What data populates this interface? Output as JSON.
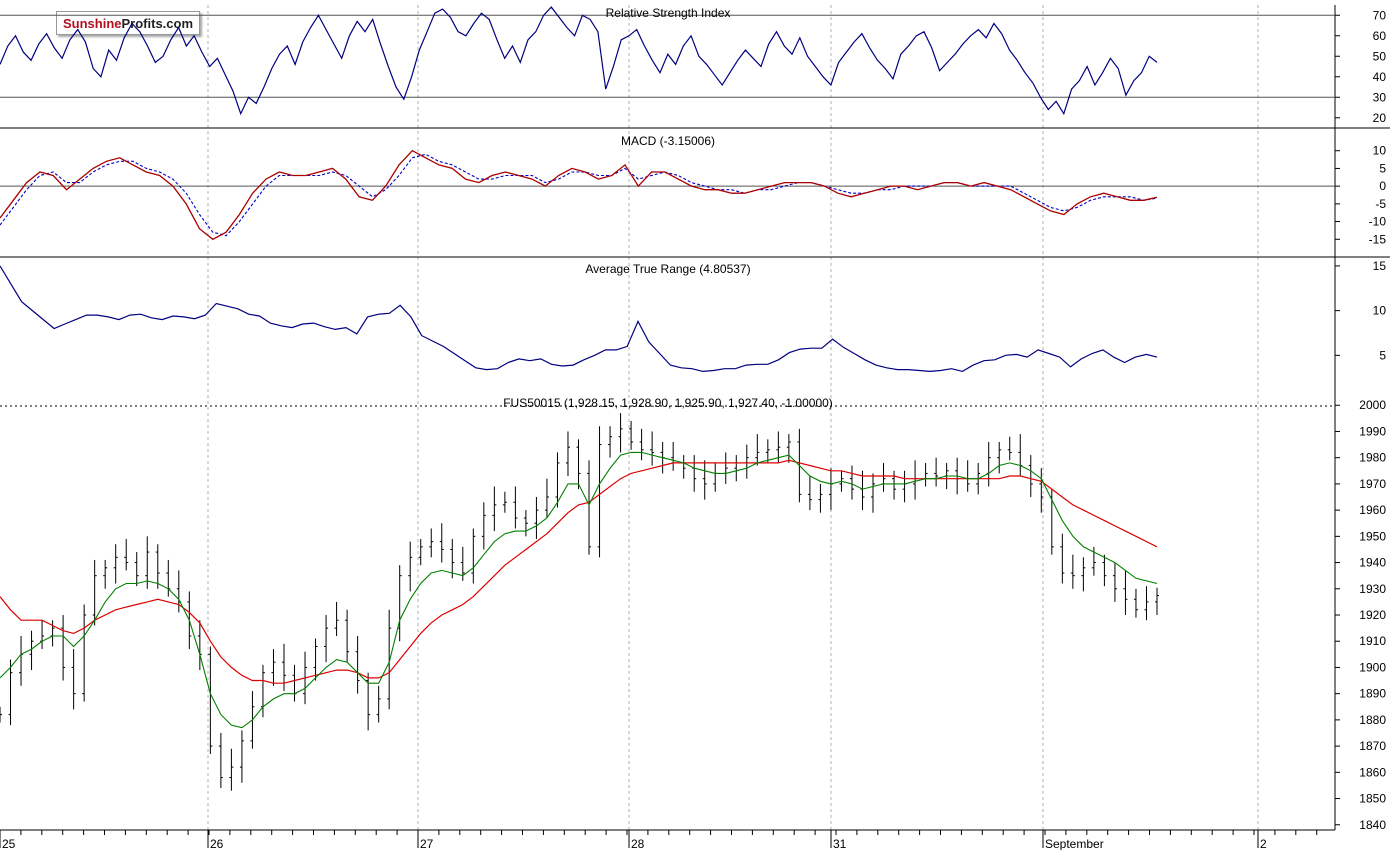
{
  "logo": {
    "part1": "Sunshine",
    "part2": "Profits.com"
  },
  "colors": {
    "price": "#000000",
    "ma_short": "#008000",
    "ma_long": "#dd0000",
    "indicator": "#000080",
    "macd": "#aa0000",
    "signal": "#0000cc",
    "grid": "#b0b0b0"
  },
  "chart_data": [
    {
      "type": "line",
      "title": "Relative Strength Index",
      "ylim": [
        15,
        75
      ],
      "yticks": [
        20,
        30,
        40,
        50,
        60,
        70
      ],
      "reference_lines": [
        30,
        70
      ],
      "series": [
        {
          "values": [
            46,
            55,
            60,
            52,
            48,
            56,
            61,
            54,
            49,
            58,
            63,
            57,
            44,
            40,
            53,
            48,
            59,
            66,
            62,
            55,
            47,
            50,
            58,
            64,
            55,
            60,
            52,
            45,
            49,
            41,
            33,
            22,
            30,
            27,
            35,
            44,
            51,
            55,
            46,
            57,
            64,
            70,
            63,
            56,
            49,
            60,
            67,
            62,
            68,
            56,
            45,
            35,
            29,
            40,
            53,
            62,
            71,
            73,
            69,
            62,
            60,
            66,
            71,
            68,
            58,
            49,
            55,
            47,
            58,
            62,
            70,
            74,
            69,
            64,
            60,
            70,
            68,
            62,
            34,
            45,
            58,
            60,
            63,
            55,
            48,
            42,
            51,
            46,
            55,
            60,
            50,
            46,
            41,
            36,
            42,
            48,
            53,
            49,
            45,
            56,
            62,
            55,
            51,
            59,
            50,
            45,
            40,
            36,
            47,
            52,
            57,
            61,
            54,
            48,
            44,
            39,
            51,
            55,
            60,
            62,
            54,
            43,
            47,
            51,
            56,
            60,
            63,
            59,
            66,
            61,
            53,
            48,
            42,
            37,
            30,
            24,
            28,
            22,
            34,
            38,
            45,
            36,
            42,
            49,
            44,
            31,
            38,
            42,
            50,
            47
          ]
        }
      ],
      "xlabel": "",
      "ylabel": ""
    },
    {
      "type": "line",
      "title": "MACD (-3.15006)",
      "ylim": [
        -20,
        15
      ],
      "yticks": [
        -15,
        -10,
        -5,
        0,
        5,
        10
      ],
      "reference_lines": [
        0
      ],
      "series": [
        {
          "values": [
            -9,
            -4,
            1,
            4,
            3,
            -1,
            2,
            5,
            7,
            8,
            6,
            4,
            3,
            0,
            -5,
            -12,
            -15,
            -13,
            -8,
            -2,
            2,
            4,
            3,
            3,
            4,
            5,
            2,
            -3,
            -4,
            0,
            6,
            10,
            8,
            6,
            5,
            2,
            1,
            3,
            4,
            3,
            2,
            0,
            3,
            5,
            4,
            2,
            3,
            6,
            0,
            4,
            4,
            2,
            0,
            -1,
            -1,
            -2,
            -2,
            -1,
            0,
            1,
            1,
            1,
            0,
            -2,
            -3,
            -2,
            -1,
            0,
            0,
            -1,
            0,
            1,
            1,
            0,
            1,
            0,
            -1,
            -3,
            -5,
            -7,
            -8,
            -5,
            -3,
            -2,
            -3,
            -4,
            -4,
            -3.15
          ]
        },
        {
          "values": [
            -11,
            -6,
            -1,
            3,
            4,
            1,
            1,
            4,
            6,
            7,
            7,
            5,
            4,
            2,
            -2,
            -8,
            -13,
            -14,
            -10,
            -5,
            0,
            3,
            3,
            3,
            3,
            4,
            3,
            0,
            -3,
            -1,
            3,
            8,
            9,
            7,
            6,
            4,
            2,
            2,
            3,
            3,
            3,
            1,
            2,
            4,
            4,
            3,
            3,
            5,
            2,
            3,
            4,
            3,
            1,
            0,
            -1,
            -1,
            -2,
            -1,
            -1,
            0,
            1,
            1,
            0,
            -1,
            -2,
            -2,
            -1,
            -1,
            0,
            0,
            0,
            1,
            1,
            0,
            0,
            0,
            0,
            -2,
            -4,
            -6,
            -7,
            -6,
            -4,
            -3,
            -3,
            -3,
            -4,
            -3.4
          ]
        }
      ],
      "xlabel": "",
      "ylabel": ""
    },
    {
      "type": "line",
      "title": "Average True Range (4.80537)",
      "ylim": [
        0,
        16
      ],
      "yticks": [
        5,
        10,
        15
      ],
      "series": [
        {
          "values": [
            15,
            13,
            11,
            10,
            9,
            8,
            8.5,
            9,
            9.5,
            9.5,
            9.3,
            9,
            9.5,
            9.6,
            9.2,
            9,
            9.4,
            9.3,
            9.1,
            9.5,
            10.8,
            10.5,
            10.2,
            9.6,
            9.4,
            8.6,
            8.3,
            8.1,
            8.5,
            8.6,
            8.2,
            7.9,
            8.1,
            7.4,
            9.3,
            9.6,
            9.7,
            10.6,
            9.3,
            7.2,
            6.6,
            6,
            5.2,
            4.4,
            3.6,
            3.4,
            3.5,
            4.2,
            4.6,
            4.4,
            4.6,
            4,
            3.8,
            3.9,
            4.5,
            5,
            5.6,
            5.6,
            6,
            8.8,
            6.5,
            5.2,
            3.9,
            3.6,
            3.5,
            3.2,
            3.3,
            3.5,
            3.5,
            3.9,
            4,
            4,
            4.5,
            5.3,
            5.7,
            5.8,
            5.8,
            6.8,
            5.9,
            5.2,
            4.5,
            3.9,
            3.6,
            3.4,
            3.4,
            3.3,
            3.2,
            3.3,
            3.5,
            3.2,
            3.9,
            4.4,
            4.5,
            5,
            5.1,
            4.8,
            5.6,
            5.2,
            4.8,
            3.7,
            4.6,
            5.2,
            5.6,
            4.8,
            4.2,
            4.8,
            5.1,
            4.805
          ]
        }
      ],
      "xlabel": "",
      "ylabel": ""
    },
    {
      "type": "line",
      "title": "FUS50015 (1,928.15, 1,928.90, 1,925.90, 1,927.40, -1.00000)",
      "ylim": [
        1838,
        2002
      ],
      "yticks": [
        1840,
        1850,
        1860,
        1870,
        1880,
        1890,
        1900,
        1910,
        1920,
        1930,
        1940,
        1950,
        1960,
        1970,
        1980,
        1990,
        2000
      ],
      "x_labels": [
        "25",
        "26",
        "27",
        "28",
        "31",
        "September",
        "2"
      ],
      "series": [
        {
          "values": [
            1882,
            1898,
            1905,
            1910,
            1912,
            1915,
            1900,
            1890,
            1920,
            1935,
            1938,
            1942,
            1940,
            1935,
            1944,
            1936,
            1930,
            1925,
            1912,
            1905,
            1870,
            1858,
            1862,
            1872,
            1885,
            1898,
            1902,
            1897,
            1890,
            1900,
            1908,
            1915,
            1918,
            1906,
            1895,
            1882,
            1888,
            1915,
            1935,
            1942,
            1946,
            1948,
            1945,
            1940,
            1936,
            1950,
            1958,
            1962,
            1963,
            1957,
            1955,
            1960,
            1965,
            1978,
            1984,
            1974,
            1946,
            1985,
            1988,
            1991,
            1986,
            1983,
            1982,
            1980,
            1978,
            1976,
            1972,
            1970,
            1974,
            1976,
            1978,
            1980,
            1982,
            1983,
            1984,
            1986,
            1966,
            1964,
            1966,
            1970,
            1972,
            1968,
            1965,
            1970,
            1972,
            1968,
            1970,
            1972,
            1974,
            1973,
            1975,
            1972,
            1970,
            1974,
            1980,
            1983,
            1982,
            1977,
            1970,
            1965,
            1946,
            1936,
            1935,
            1938,
            1940,
            1935,
            1930,
            1926,
            1922,
            1925,
            1927.4
          ]
        },
        {
          "values": [
            1896,
            1900,
            1905,
            1907,
            1910,
            1912,
            1912,
            1908,
            1912,
            1918,
            1925,
            1930,
            1932,
            1932,
            1933,
            1932,
            1930,
            1926,
            1918,
            1905,
            1890,
            1882,
            1878,
            1877,
            1880,
            1885,
            1888,
            1890,
            1890,
            1892,
            1896,
            1900,
            1903,
            1902,
            1898,
            1894,
            1894,
            1902,
            1918,
            1926,
            1932,
            1936,
            1937,
            1936,
            1935,
            1938,
            1943,
            1948,
            1951,
            1952,
            1952,
            1954,
            1957,
            1963,
            1970,
            1970,
            1962,
            1970,
            1976,
            1981,
            1982,
            1982,
            1981,
            1980,
            1979,
            1978,
            1976,
            1975,
            1974,
            1974,
            1975,
            1976,
            1978,
            1979,
            1980,
            1981,
            1977,
            1973,
            1971,
            1970,
            1971,
            1970,
            1968,
            1969,
            1970,
            1970,
            1970,
            1971,
            1972,
            1972,
            1973,
            1973,
            1972,
            1972,
            1974,
            1977,
            1978,
            1977,
            1975,
            1972,
            1964,
            1956,
            1950,
            1946,
            1944,
            1942,
            1940,
            1937,
            1934,
            1933,
            1932
          ]
        },
        {
          "values": [
            1927,
            1922,
            1918,
            1918,
            1918,
            1916,
            1914,
            1913,
            1915,
            1918,
            1920,
            1922,
            1923,
            1924,
            1925,
            1926,
            1925,
            1924,
            1921,
            1917,
            1910,
            1904,
            1900,
            1897,
            1895,
            1895,
            1894,
            1894,
            1895,
            1896,
            1897,
            1898,
            1899,
            1899,
            1898,
            1896,
            1896,
            1898,
            1903,
            1908,
            1913,
            1917,
            1920,
            1922,
            1924,
            1927,
            1931,
            1935,
            1939,
            1942,
            1945,
            1948,
            1951,
            1955,
            1959,
            1962,
            1963,
            1966,
            1969,
            1972,
            1974,
            1975,
            1976,
            1977,
            1978,
            1978,
            1978,
            1978,
            1978,
            1978,
            1978,
            1978,
            1978,
            1978,
            1978,
            1979,
            1978,
            1977,
            1976,
            1975,
            1975,
            1974,
            1973,
            1973,
            1973,
            1973,
            1972,
            1972,
            1972,
            1972,
            1972,
            1972,
            1972,
            1972,
            1972,
            1972,
            1973,
            1973,
            1972,
            1971,
            1968,
            1965,
            1962,
            1960,
            1958,
            1956,
            1954,
            1952,
            1950,
            1948,
            1946
          ]
        }
      ],
      "xlabel": "",
      "ylabel": ""
    }
  ]
}
